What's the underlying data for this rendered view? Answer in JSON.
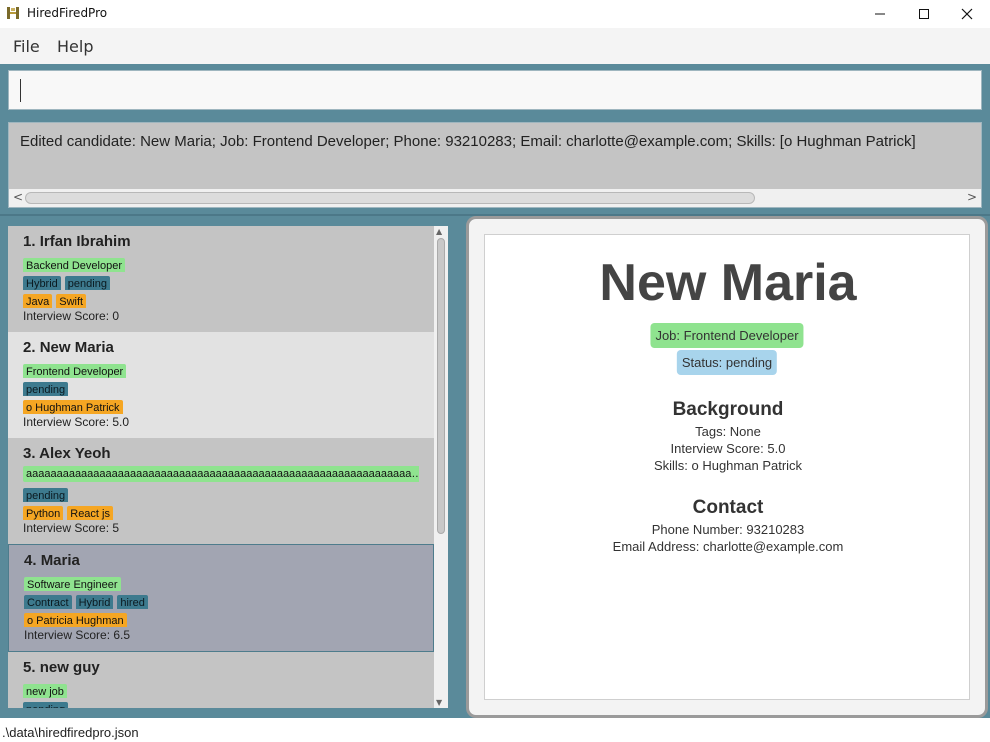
{
  "app": {
    "title": "HiredFiredPro"
  },
  "window_controls": {
    "minimize": "—",
    "maximize": "☐",
    "close": "✕"
  },
  "menu": {
    "file": "File",
    "help": "Help"
  },
  "command_box": {
    "value": ""
  },
  "result": {
    "text": "Edited candidate: New Maria; Job: Frontend Developer; Phone: 93210283; Email: charlotte@example.com; Skills: [o Hughman Patrick]"
  },
  "candidates": [
    {
      "index": "1.",
      "name": "Irfan Ibrahim",
      "job": "Backend Developer",
      "statuses": [
        "Hybrid",
        "pending"
      ],
      "skills": [
        "Java",
        "Swift"
      ],
      "score": "Interview Score: 0"
    },
    {
      "index": "2.",
      "name": "New Maria",
      "job": "Frontend Developer",
      "statuses": [
        "pending"
      ],
      "skills": [
        "o Hughman Patrick"
      ],
      "score": "Interview Score: 5.0"
    },
    {
      "index": "3.",
      "name": "Alex Yeoh",
      "job": "aaaaaaaaaaaaaaaaaaaaaaaaaaaaaaaaaaaaaaaaaaaaaaaaaaaaaaaaaaaaaaaaaaaaaaa...",
      "statuses": [
        "pending"
      ],
      "skills": [
        "Python",
        "React js"
      ],
      "score": "Interview Score: 5"
    },
    {
      "index": "4.",
      "name": "Maria",
      "job": "Software Engineer",
      "statuses": [
        "Contract",
        "Hybrid",
        "hired"
      ],
      "skills": [
        "o Patricia Hughman"
      ],
      "score": "Interview Score: 6.5"
    },
    {
      "index": "5.",
      "name": "new guy",
      "job": "new job",
      "statuses": [
        "pending"
      ],
      "skills": [],
      "score": ""
    }
  ],
  "detail": {
    "name": "New Maria",
    "job": "Job: Frontend Developer",
    "status": "Status: pending",
    "background_heading": "Background",
    "tags": "Tags: None",
    "interview_score": "Interview Score: 5.0",
    "skills": "Skills: o Hughman Patrick",
    "contact_heading": "Contact",
    "phone": "Phone Number: 93210283",
    "email": "Email Address: charlotte@example.com"
  },
  "status_bar": {
    "path": ".\\data\\hiredfiredpro.json"
  },
  "colors": {
    "accent_teal": "#5a8a9a",
    "job_tag": "#8fe38f",
    "status_tag": "#3d7a8e",
    "skill_tag": "#f5a623",
    "selected_card": "#a2a5b2"
  }
}
